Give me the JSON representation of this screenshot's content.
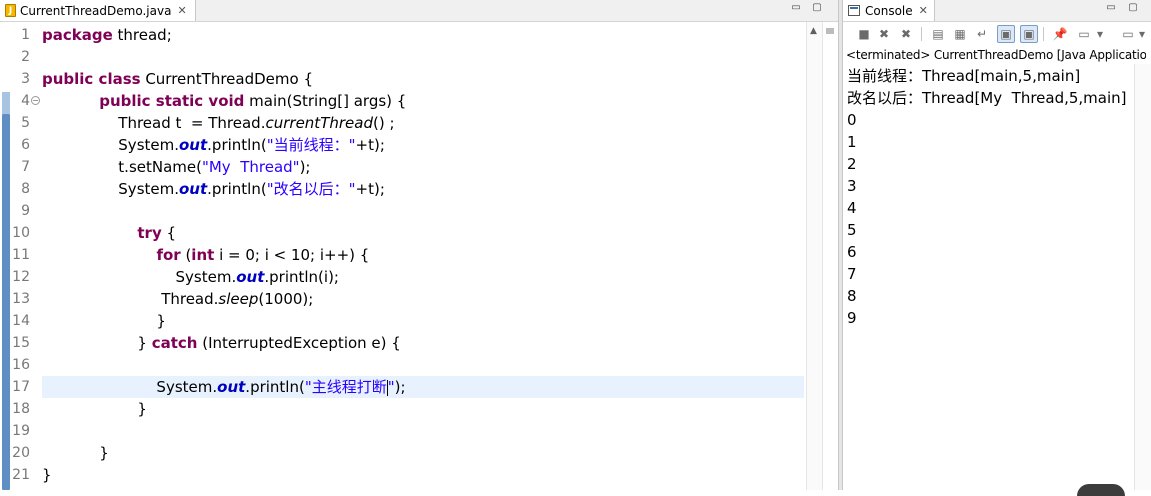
{
  "editor": {
    "tab_title": "CurrentThreadDemo.java",
    "tab_icon": "java-file-icon",
    "minimize_glyph": "▭",
    "maximize_glyph": "▢",
    "line_numbers": [
      "1",
      "2",
      "3",
      "4",
      "5",
      "6",
      "7",
      "8",
      "9",
      "10",
      "11",
      "12",
      "13",
      "14",
      "15",
      "16",
      "17",
      "18",
      "19",
      "20",
      "21"
    ],
    "current_line": 17,
    "lines": [
      {
        "parts": [
          {
            "t": "package",
            "c": "kw"
          },
          {
            "t": " thread;"
          }
        ]
      },
      {
        "parts": []
      },
      {
        "parts": [
          {
            "t": "public class",
            "c": "kw"
          },
          {
            "t": " CurrentThreadDemo {"
          }
        ]
      },
      {
        "parts": [
          {
            "t": "            "
          },
          {
            "t": "public static void",
            "c": "kw"
          },
          {
            "t": " main(String[] args) {"
          }
        ]
      },
      {
        "parts": [
          {
            "t": "                Thread t  = Thread."
          },
          {
            "t": "currentThread",
            "c": "it"
          },
          {
            "t": "() ;"
          }
        ]
      },
      {
        "parts": [
          {
            "t": "                System."
          },
          {
            "t": "out",
            "c": "fld"
          },
          {
            "t": ".println("
          },
          {
            "t": "\"当前线程：\"",
            "c": "str"
          },
          {
            "t": "+t);"
          }
        ]
      },
      {
        "parts": [
          {
            "t": "                t.setName("
          },
          {
            "t": "\"My  Thread\"",
            "c": "str"
          },
          {
            "t": ");"
          }
        ]
      },
      {
        "parts": [
          {
            "t": "                System."
          },
          {
            "t": "out",
            "c": "fld"
          },
          {
            "t": ".println("
          },
          {
            "t": "\"改名以后：\"",
            "c": "str"
          },
          {
            "t": "+t);"
          }
        ]
      },
      {
        "parts": []
      },
      {
        "parts": [
          {
            "t": "                    "
          },
          {
            "t": "try",
            "c": "kw"
          },
          {
            "t": " {"
          }
        ]
      },
      {
        "parts": [
          {
            "t": "                        "
          },
          {
            "t": "for",
            "c": "kw"
          },
          {
            "t": " ("
          },
          {
            "t": "int",
            "c": "kw"
          },
          {
            "t": " i = 0; i < 10; i++) {"
          }
        ]
      },
      {
        "parts": [
          {
            "t": "                            System."
          },
          {
            "t": "out",
            "c": "fld"
          },
          {
            "t": ".println(i);"
          }
        ]
      },
      {
        "parts": [
          {
            "t": "                         Thread."
          },
          {
            "t": "sleep",
            "c": "it"
          },
          {
            "t": "(1000);"
          }
        ]
      },
      {
        "parts": [
          {
            "t": "                        }"
          }
        ]
      },
      {
        "parts": [
          {
            "t": "                    } "
          },
          {
            "t": "catch",
            "c": "kw"
          },
          {
            "t": " (InterruptedException e) {"
          }
        ]
      },
      {
        "parts": []
      },
      {
        "parts": [
          {
            "t": "                        System."
          },
          {
            "t": "out",
            "c": "fld"
          },
          {
            "t": ".println("
          },
          {
            "t": "\"主线程打断",
            "c": "str"
          },
          {
            "t": "",
            "caret": true
          },
          {
            "t": "\"",
            "c": "str"
          },
          {
            "t": ");"
          }
        ]
      },
      {
        "parts": [
          {
            "t": "                    }"
          }
        ]
      },
      {
        "parts": []
      },
      {
        "parts": [
          {
            "t": "            }"
          }
        ]
      },
      {
        "parts": [
          {
            "t": "}"
          }
        ]
      }
    ]
  },
  "console": {
    "tab_title": "Console",
    "status": "<terminated> CurrentThreadDemo [Java Application]",
    "toolbar": [
      {
        "name": "terminate-icon",
        "glyph": "■"
      },
      {
        "name": "remove-launch-icon",
        "glyph": "✖"
      },
      {
        "name": "remove-all-terminated-icon",
        "glyph": "✖"
      },
      {
        "name": "clear-console-icon",
        "glyph": "▤"
      },
      {
        "name": "scroll-lock-icon",
        "glyph": "▦"
      },
      {
        "name": "word-wrap-icon",
        "glyph": "↵"
      },
      {
        "name": "show-on-stdout-icon",
        "glyph": "▣",
        "active": true
      },
      {
        "name": "show-on-stderr-icon",
        "glyph": "▣",
        "active": true
      },
      {
        "name": "pin-console-icon",
        "glyph": "📌"
      },
      {
        "name": "display-console-icon",
        "glyph": "▭"
      },
      {
        "name": "display-console-dropdown-icon",
        "glyph": "▾"
      },
      {
        "name": "open-console-icon",
        "glyph": "▭"
      },
      {
        "name": "open-console-dropdown-icon",
        "glyph": "▾"
      }
    ],
    "output": [
      "当前线程：Thread[main,5,main]",
      "改名以后：Thread[My  Thread,5,main]",
      "0",
      "1",
      "2",
      "3",
      "4",
      "5",
      "6",
      "7",
      "8",
      "9"
    ]
  }
}
